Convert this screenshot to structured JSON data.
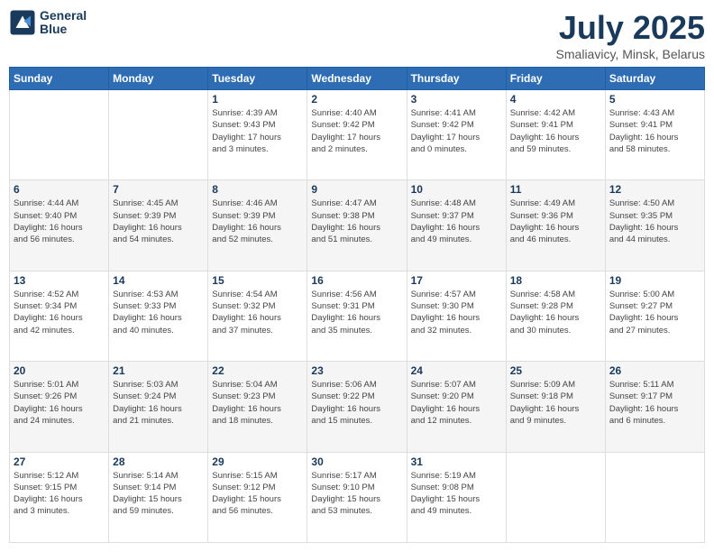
{
  "logo": {
    "line1": "General",
    "line2": "Blue"
  },
  "title": "July 2025",
  "subtitle": "Smaliavicy, Minsk, Belarus",
  "days_header": [
    "Sunday",
    "Monday",
    "Tuesday",
    "Wednesday",
    "Thursday",
    "Friday",
    "Saturday"
  ],
  "weeks": [
    [
      {
        "day": "",
        "info": ""
      },
      {
        "day": "",
        "info": ""
      },
      {
        "day": "1",
        "info": "Sunrise: 4:39 AM\nSunset: 9:43 PM\nDaylight: 17 hours\nand 3 minutes."
      },
      {
        "day": "2",
        "info": "Sunrise: 4:40 AM\nSunset: 9:42 PM\nDaylight: 17 hours\nand 2 minutes."
      },
      {
        "day": "3",
        "info": "Sunrise: 4:41 AM\nSunset: 9:42 PM\nDaylight: 17 hours\nand 0 minutes."
      },
      {
        "day": "4",
        "info": "Sunrise: 4:42 AM\nSunset: 9:41 PM\nDaylight: 16 hours\nand 59 minutes."
      },
      {
        "day": "5",
        "info": "Sunrise: 4:43 AM\nSunset: 9:41 PM\nDaylight: 16 hours\nand 58 minutes."
      }
    ],
    [
      {
        "day": "6",
        "info": "Sunrise: 4:44 AM\nSunset: 9:40 PM\nDaylight: 16 hours\nand 56 minutes."
      },
      {
        "day": "7",
        "info": "Sunrise: 4:45 AM\nSunset: 9:39 PM\nDaylight: 16 hours\nand 54 minutes."
      },
      {
        "day": "8",
        "info": "Sunrise: 4:46 AM\nSunset: 9:39 PM\nDaylight: 16 hours\nand 52 minutes."
      },
      {
        "day": "9",
        "info": "Sunrise: 4:47 AM\nSunset: 9:38 PM\nDaylight: 16 hours\nand 51 minutes."
      },
      {
        "day": "10",
        "info": "Sunrise: 4:48 AM\nSunset: 9:37 PM\nDaylight: 16 hours\nand 49 minutes."
      },
      {
        "day": "11",
        "info": "Sunrise: 4:49 AM\nSunset: 9:36 PM\nDaylight: 16 hours\nand 46 minutes."
      },
      {
        "day": "12",
        "info": "Sunrise: 4:50 AM\nSunset: 9:35 PM\nDaylight: 16 hours\nand 44 minutes."
      }
    ],
    [
      {
        "day": "13",
        "info": "Sunrise: 4:52 AM\nSunset: 9:34 PM\nDaylight: 16 hours\nand 42 minutes."
      },
      {
        "day": "14",
        "info": "Sunrise: 4:53 AM\nSunset: 9:33 PM\nDaylight: 16 hours\nand 40 minutes."
      },
      {
        "day": "15",
        "info": "Sunrise: 4:54 AM\nSunset: 9:32 PM\nDaylight: 16 hours\nand 37 minutes."
      },
      {
        "day": "16",
        "info": "Sunrise: 4:56 AM\nSunset: 9:31 PM\nDaylight: 16 hours\nand 35 minutes."
      },
      {
        "day": "17",
        "info": "Sunrise: 4:57 AM\nSunset: 9:30 PM\nDaylight: 16 hours\nand 32 minutes."
      },
      {
        "day": "18",
        "info": "Sunrise: 4:58 AM\nSunset: 9:28 PM\nDaylight: 16 hours\nand 30 minutes."
      },
      {
        "day": "19",
        "info": "Sunrise: 5:00 AM\nSunset: 9:27 PM\nDaylight: 16 hours\nand 27 minutes."
      }
    ],
    [
      {
        "day": "20",
        "info": "Sunrise: 5:01 AM\nSunset: 9:26 PM\nDaylight: 16 hours\nand 24 minutes."
      },
      {
        "day": "21",
        "info": "Sunrise: 5:03 AM\nSunset: 9:24 PM\nDaylight: 16 hours\nand 21 minutes."
      },
      {
        "day": "22",
        "info": "Sunrise: 5:04 AM\nSunset: 9:23 PM\nDaylight: 16 hours\nand 18 minutes."
      },
      {
        "day": "23",
        "info": "Sunrise: 5:06 AM\nSunset: 9:22 PM\nDaylight: 16 hours\nand 15 minutes."
      },
      {
        "day": "24",
        "info": "Sunrise: 5:07 AM\nSunset: 9:20 PM\nDaylight: 16 hours\nand 12 minutes."
      },
      {
        "day": "25",
        "info": "Sunrise: 5:09 AM\nSunset: 9:18 PM\nDaylight: 16 hours\nand 9 minutes."
      },
      {
        "day": "26",
        "info": "Sunrise: 5:11 AM\nSunset: 9:17 PM\nDaylight: 16 hours\nand 6 minutes."
      }
    ],
    [
      {
        "day": "27",
        "info": "Sunrise: 5:12 AM\nSunset: 9:15 PM\nDaylight: 16 hours\nand 3 minutes."
      },
      {
        "day": "28",
        "info": "Sunrise: 5:14 AM\nSunset: 9:14 PM\nDaylight: 15 hours\nand 59 minutes."
      },
      {
        "day": "29",
        "info": "Sunrise: 5:15 AM\nSunset: 9:12 PM\nDaylight: 15 hours\nand 56 minutes."
      },
      {
        "day": "30",
        "info": "Sunrise: 5:17 AM\nSunset: 9:10 PM\nDaylight: 15 hours\nand 53 minutes."
      },
      {
        "day": "31",
        "info": "Sunrise: 5:19 AM\nSunset: 9:08 PM\nDaylight: 15 hours\nand 49 minutes."
      },
      {
        "day": "",
        "info": ""
      },
      {
        "day": "",
        "info": ""
      }
    ]
  ]
}
